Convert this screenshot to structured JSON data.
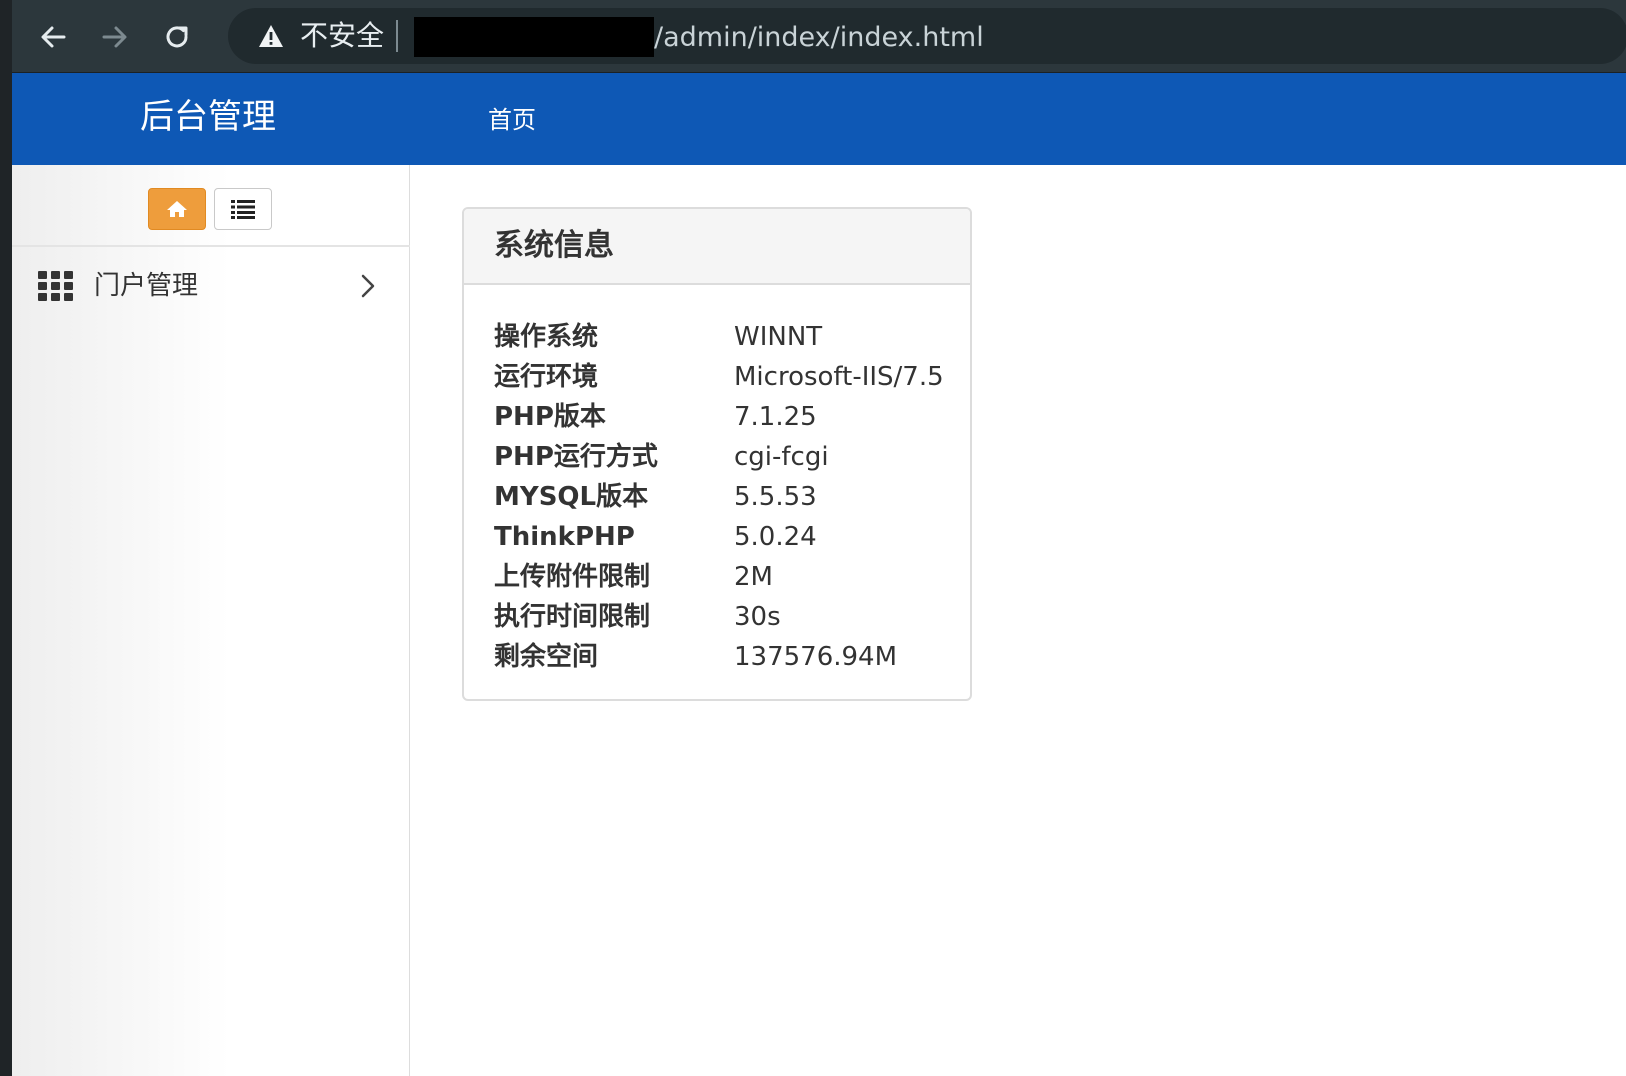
{
  "browser": {
    "security_label": "不安全",
    "url_visible": "/admin/index/index.html"
  },
  "header": {
    "app_title": "后台管理",
    "nav_home": "首页",
    "brand_color": "#0e58b5"
  },
  "sidebar": {
    "tools": [
      {
        "icon": "home-icon",
        "active": true,
        "color": "#ee9d3c"
      },
      {
        "icon": "list-icon",
        "active": false
      }
    ],
    "items": [
      {
        "icon": "grid-icon",
        "label": "门户管理",
        "expand_icon": "chevron-right-icon"
      }
    ]
  },
  "system_info": {
    "title": "系统信息",
    "rows": [
      {
        "label": "操作系统",
        "value": "WINNT"
      },
      {
        "label": "运行环境",
        "value": "Microsoft-IIS/7.5"
      },
      {
        "label": "PHP版本",
        "value": "7.1.25"
      },
      {
        "label": "PHP运行方式",
        "value": "cgi-fcgi"
      },
      {
        "label": "MYSQL版本",
        "value": "5.5.53"
      },
      {
        "label": "ThinkPHP",
        "value": "5.0.24"
      },
      {
        "label": "上传附件限制",
        "value": "2M"
      },
      {
        "label": "执行时间限制",
        "value": "30s"
      },
      {
        "label": "剩余空间",
        "value": "137576.94M"
      }
    ]
  }
}
